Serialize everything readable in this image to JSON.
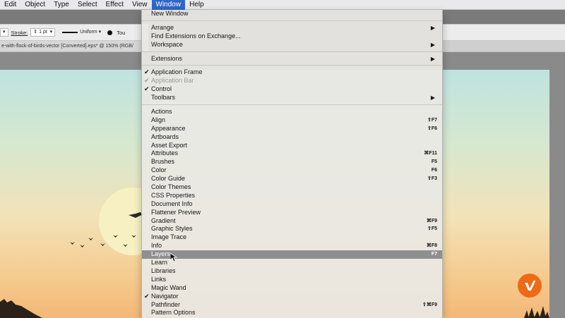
{
  "menubar": {
    "items": [
      "Edit",
      "Object",
      "Type",
      "Select",
      "Effect",
      "View",
      "Window",
      "Help"
    ],
    "active": "Window"
  },
  "control_bar": {
    "stroke_label": "Stroke:",
    "stroke_weight": "1 pt",
    "profile": "Uniform",
    "brush_truncated": "Tou"
  },
  "document_tab": {
    "title": "e-with-flock-of-birds-vector [Converted].eps* @ 150% (RGB/"
  },
  "window_menu": {
    "groups": [
      [
        {
          "label": "New Window"
        }
      ],
      [
        {
          "label": "Arrange",
          "submenu": true
        },
        {
          "label": "Find Extensions on Exchange..."
        },
        {
          "label": "Workspace",
          "submenu": true
        }
      ],
      [
        {
          "label": "Extensions",
          "submenu": true
        }
      ],
      [
        {
          "label": "Application Frame",
          "checked": true
        },
        {
          "label": "Application Bar",
          "checked": true,
          "disabled": true
        },
        {
          "label": "Control",
          "checked": true
        },
        {
          "label": "Toolbars",
          "submenu": true
        }
      ],
      [
        {
          "label": "Actions"
        },
        {
          "label": "Align",
          "shortcut": "⇧F7"
        },
        {
          "label": "Appearance",
          "shortcut": "⇧F6"
        },
        {
          "label": "Artboards"
        },
        {
          "label": "Asset Export"
        },
        {
          "label": "Attributes",
          "shortcut": "⌘F11"
        },
        {
          "label": "Brushes",
          "shortcut": "F5"
        },
        {
          "label": "Color",
          "shortcut": "F6"
        },
        {
          "label": "Color Guide",
          "shortcut": "⇧F3"
        },
        {
          "label": "Color Themes"
        },
        {
          "label": "CSS Properties"
        },
        {
          "label": "Document Info"
        },
        {
          "label": "Flattener Preview"
        },
        {
          "label": "Gradient",
          "shortcut": "⌘F9"
        },
        {
          "label": "Graphic Styles",
          "shortcut": "⇧F5"
        },
        {
          "label": "Image Trace"
        },
        {
          "label": "Info",
          "shortcut": "⌘F8"
        },
        {
          "label": "Layers",
          "shortcut": "F7",
          "highlighted": true
        },
        {
          "label": "Learn"
        },
        {
          "label": "Libraries"
        },
        {
          "label": "Links"
        },
        {
          "label": "Magic Wand"
        },
        {
          "label": "Navigator",
          "checked": true
        },
        {
          "label": "Pathfinder",
          "shortcut": "⇧⌘F9"
        },
        {
          "label": "Pattern Options"
        }
      ]
    ]
  },
  "icons": {
    "check": "checkmark-icon",
    "submenu": "submenu-arrow-icon",
    "cursor": "mouse-pointer-icon",
    "watermark": "vimeo-style-logo"
  },
  "colors": {
    "menu_active": "#2f66c8",
    "highlight": "#8f8f8f",
    "logo": "#ee6a16",
    "sun": "#f7f0c2"
  }
}
